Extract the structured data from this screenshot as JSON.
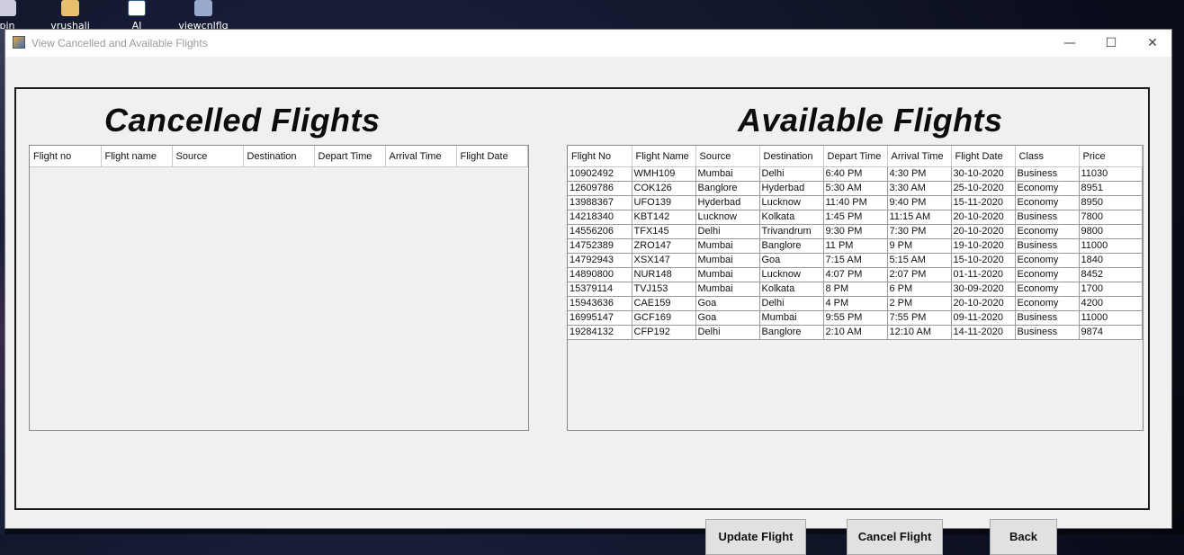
{
  "desktop": {
    "icons": [
      {
        "name": "desktop-icon-pin",
        "label": "pin"
      },
      {
        "name": "desktop-icon-vrushali",
        "label": "vrushali"
      },
      {
        "name": "desktop-icon-ai",
        "label": "AI"
      },
      {
        "name": "desktop-icon-viewcnlflg",
        "label": "viewcnlflg"
      }
    ]
  },
  "window": {
    "title": "View Cancelled and Available Flights",
    "controls": {
      "minimize": "—",
      "maximize": "☐",
      "close": "✕"
    }
  },
  "cancelled": {
    "heading": "Cancelled Flights",
    "columns": [
      "Flight no",
      "Flight name",
      "Source",
      "Destination",
      "Depart Time",
      "Arrival Time",
      "Flight Date"
    ],
    "rows": []
  },
  "available": {
    "heading": "Available Flights",
    "columns": [
      "Flight No",
      "Flight Name",
      "Source",
      "Destination",
      "Depart Time",
      "Arrival Time",
      "Flight Date",
      "Class",
      "Price"
    ],
    "rows": [
      [
        "10902492",
        "WMH109",
        "Mumbai",
        "Delhi",
        "6:40 PM",
        "4:30 PM",
        "30-10-2020",
        "Business",
        "11030"
      ],
      [
        "12609786",
        "COK126",
        "Banglore",
        "Hyderbad",
        "5:30 AM",
        "3:30 AM",
        "25-10-2020",
        "Economy",
        "8951"
      ],
      [
        "13988367",
        "UFO139",
        "Hyderbad",
        "Lucknow",
        "11:40 PM",
        "9:40 PM",
        "15-11-2020",
        "Economy",
        "8950"
      ],
      [
        "14218340",
        "KBT142",
        "Lucknow",
        "Kolkata",
        "1:45 PM",
        "11:15 AM",
        "20-10-2020",
        "Business",
        "7800"
      ],
      [
        "14556206",
        "TFX145",
        "Delhi",
        "Trivandrum",
        "9:30 PM",
        "7:30 PM",
        "20-10-2020",
        "Economy",
        "9800"
      ],
      [
        "14752389",
        "ZRO147",
        "Mumbai",
        "Banglore",
        "11 PM",
        "9 PM",
        "19-10-2020",
        "Business",
        "11000"
      ],
      [
        "14792943",
        "XSX147",
        "Mumbai",
        "Goa",
        "7:15 AM",
        "5:15 AM",
        "15-10-2020",
        "Economy",
        "1840"
      ],
      [
        "14890800",
        "NUR148",
        "Mumbai",
        "Lucknow",
        "4:07 PM",
        "2:07 PM",
        "01-11-2020",
        "Economy",
        "8452"
      ],
      [
        "15379114",
        "TVJ153",
        "Mumbai",
        "Kolkata",
        "8 PM",
        "6 PM",
        "30-09-2020",
        "Economy",
        "1700"
      ],
      [
        "15943636",
        "CAE159",
        "Goa",
        "Delhi",
        "4 PM",
        "2 PM",
        "20-10-2020",
        "Economy",
        "4200"
      ],
      [
        "16995147",
        "GCF169",
        "Goa",
        "Mumbai",
        "9:55 PM",
        "7:55 PM",
        "09-11-2020",
        "Business",
        "11000"
      ],
      [
        "19284132",
        "CFP192",
        "Delhi",
        "Banglore",
        "2:10 AM",
        "12:10 AM",
        "14-11-2020",
        "Business",
        "9874"
      ]
    ]
  },
  "buttons": {
    "update": "Update Flight",
    "cancel": "Cancel Flight",
    "back": "Back"
  }
}
